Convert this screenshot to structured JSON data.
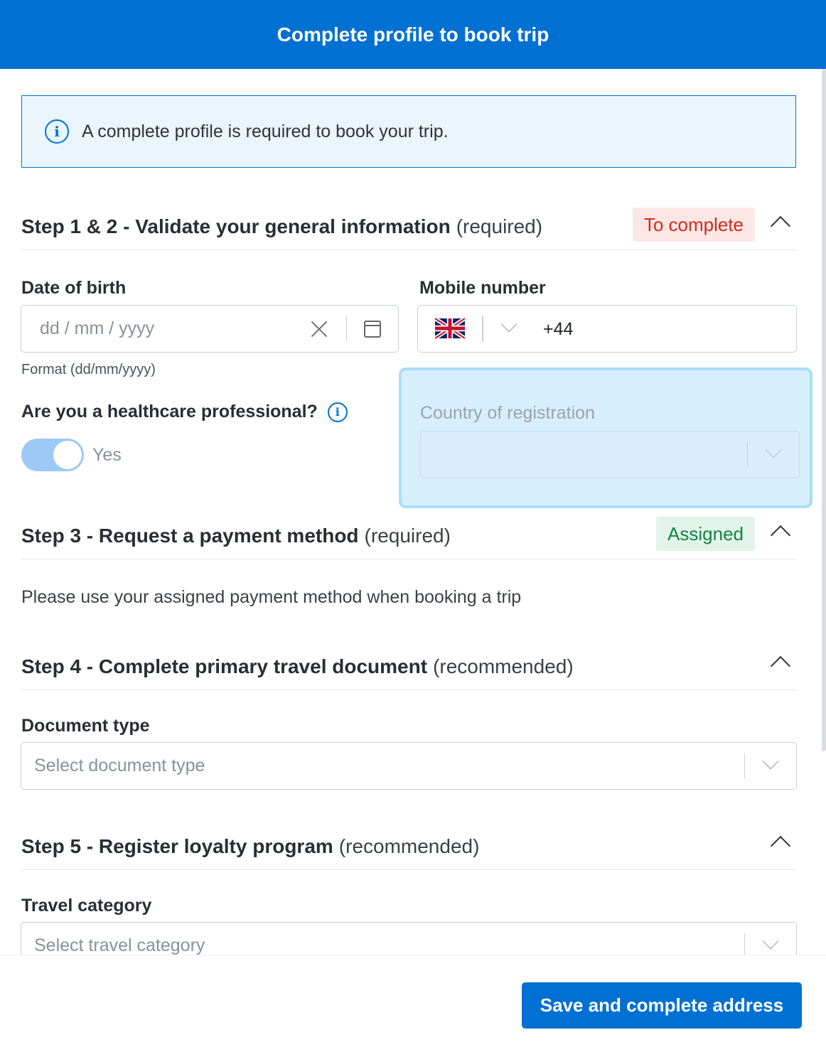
{
  "header": {
    "title": "Complete profile to book trip"
  },
  "info_banner": {
    "icon": "info-icon",
    "text": "A complete profile is required to book your trip."
  },
  "step12": {
    "title": "Step 1 & 2 - Validate your general information",
    "suffix": "(required)",
    "badge": "To complete",
    "badge_color": "#d32a1b",
    "dob": {
      "label": "Date of birth",
      "placeholder": "dd / mm / yyyy",
      "helper": "Format (dd/mm/yyyy)"
    },
    "mobile": {
      "label": "Mobile number",
      "country_flag": "uk-flag-icon",
      "value": "+44"
    },
    "healthcare": {
      "label": "Are you a healthcare professional?",
      "toggle_label": "Yes",
      "toggle_on": true
    },
    "country_registration": {
      "label": "Country of registration",
      "value": ""
    }
  },
  "step3": {
    "title": "Step 3 - Request a payment method",
    "suffix": "(required)",
    "badge": "Assigned",
    "badge_color": "#148447",
    "description": "Please use your assigned payment method when booking a trip"
  },
  "step4": {
    "title": "Step 4 - Complete primary travel document",
    "suffix": "(recommended)",
    "doc_type": {
      "label": "Document type",
      "placeholder": "Select document type"
    }
  },
  "step5": {
    "title": "Step 5 - Register loyalty program",
    "suffix": "(recommended)",
    "travel_category": {
      "label": "Travel category",
      "placeholder": "Select travel category"
    }
  },
  "footer": {
    "primary_button": "Save and complete address"
  },
  "colors": {
    "brand": "#0070d2",
    "banner_bg": "#eaf5fe",
    "highlight": "#d7effd"
  }
}
